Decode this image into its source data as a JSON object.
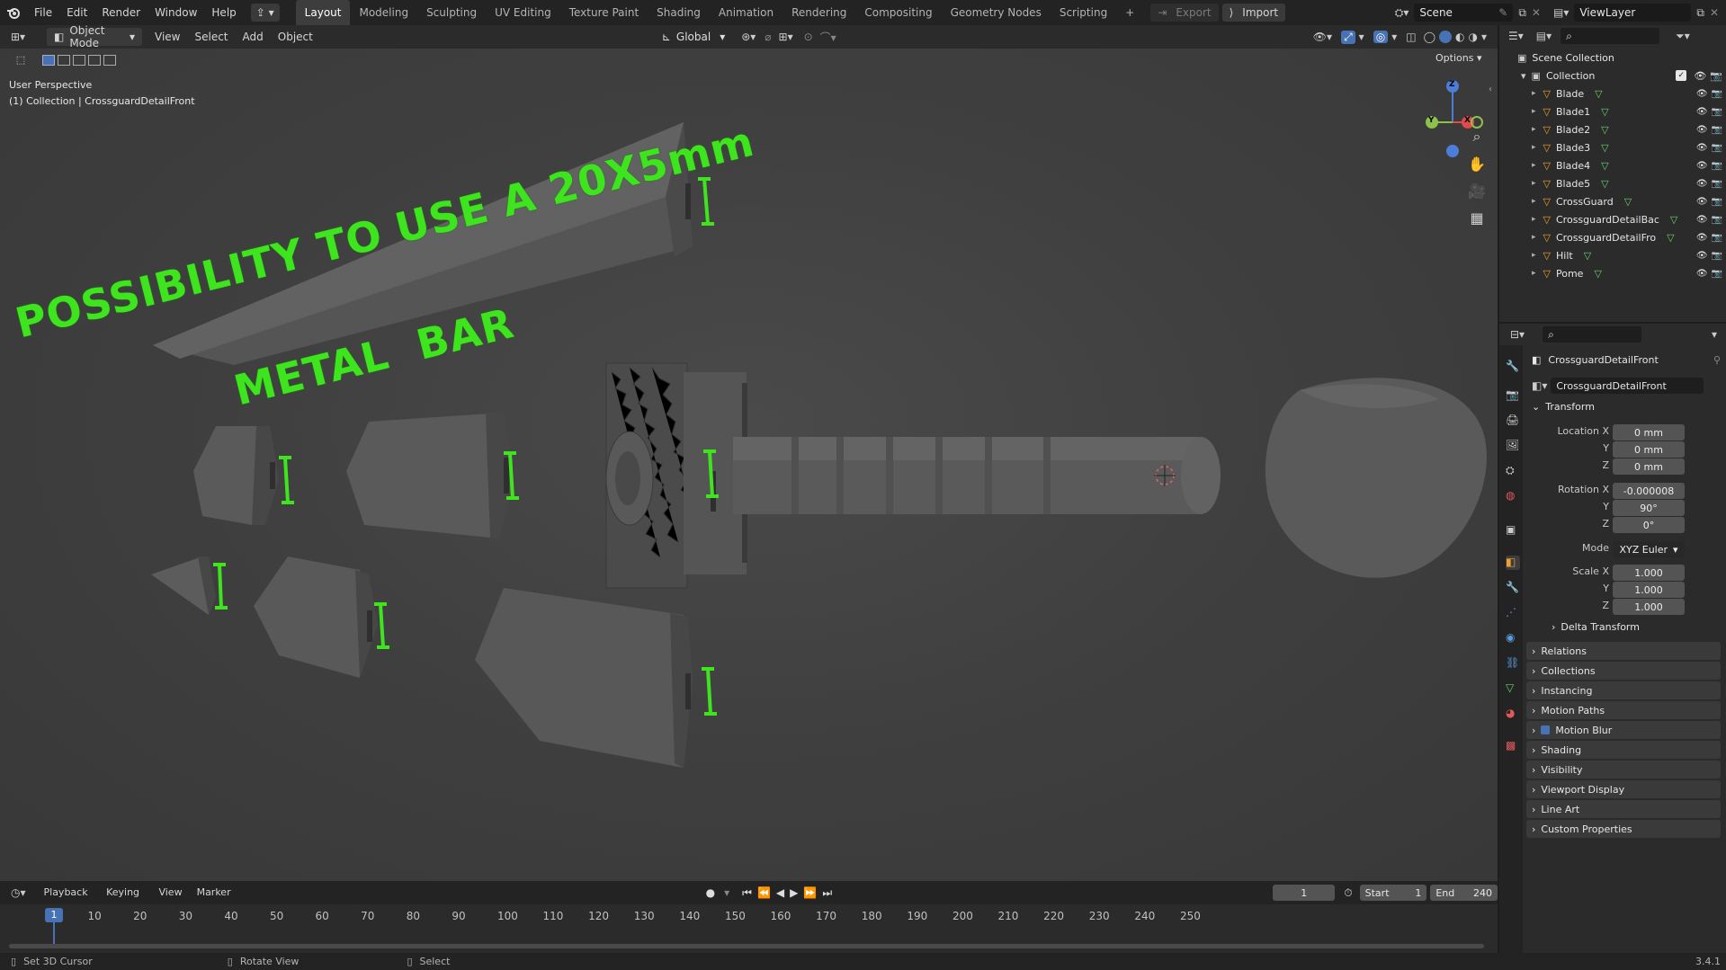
{
  "app": {
    "logo_icon": "blender-logo-icon"
  },
  "menu": [
    "File",
    "Edit",
    "Render",
    "Window",
    "Help"
  ],
  "workspaces": {
    "tabs": [
      "Layout",
      "Modeling",
      "Sculpting",
      "UV Editing",
      "Texture Paint",
      "Shading",
      "Animation",
      "Rendering",
      "Compositing",
      "Geometry Nodes",
      "Scripting"
    ],
    "active": "Layout",
    "add": "+"
  },
  "topbar": {
    "export_label": "Export",
    "import_label": "Import",
    "scene_label": "Scene",
    "viewlayer_label": "ViewLayer"
  },
  "viewport_header": {
    "mode": "Object Mode",
    "menus": [
      "View",
      "Select",
      "Add",
      "Object"
    ],
    "transform_orientation": "Global",
    "options_label": "Options"
  },
  "viewport": {
    "view_name": "User Perspective",
    "context": "(1) Collection | CrossguardDetailFront",
    "overlay_text_line1": "POSSIBILITY TO USE A 20X5mm",
    "overlay_text_line2": "METAL  BAR",
    "overlay_color": "#3ee51f",
    "gizmo": {
      "z": "Z",
      "y": "Y",
      "x": "X"
    }
  },
  "outliner": {
    "scene_collection": "Scene Collection",
    "collection": "Collection",
    "items": [
      {
        "name": "Blade"
      },
      {
        "name": "Blade1"
      },
      {
        "name": "Blade2"
      },
      {
        "name": "Blade3"
      },
      {
        "name": "Blade4"
      },
      {
        "name": "Blade5"
      },
      {
        "name": "CrossGuard"
      },
      {
        "name": "CrossguardDetailBac"
      },
      {
        "name": "CrossguardDetailFro"
      },
      {
        "name": "Hilt"
      },
      {
        "name": "Pome"
      }
    ]
  },
  "properties": {
    "object_name": "CrossguardDetailFront",
    "datablock_name": "CrossguardDetailFront",
    "transform_label": "Transform",
    "location": {
      "label": "Location X",
      "x": "0 mm",
      "y": "0 mm",
      "z": "0 mm"
    },
    "rotation": {
      "label": "Rotation X",
      "x": "-0.000008",
      "y": "90°",
      "z": "0°"
    },
    "mode_label": "Mode",
    "mode_value": "XYZ Euler",
    "scale": {
      "label": "Scale X",
      "x": "1.000",
      "y": "1.000",
      "z": "1.000"
    },
    "axis_y": "Y",
    "axis_z": "Z",
    "delta_transform": "Delta Transform",
    "panels": [
      "Relations",
      "Collections",
      "Instancing",
      "Motion Paths",
      "Motion Blur",
      "Shading",
      "Visibility",
      "Viewport Display",
      "Line Art",
      "Custom Properties"
    ]
  },
  "timeline": {
    "menus": [
      "Playback",
      "Keying",
      "View",
      "Marker"
    ],
    "current_frame": "1",
    "start_label": "Start",
    "start_value": "1",
    "end_label": "End",
    "end_value": "240",
    "ticks": [
      "1",
      "10",
      "20",
      "30",
      "40",
      "50",
      "60",
      "70",
      "80",
      "90",
      "100",
      "110",
      "120",
      "130",
      "140",
      "150",
      "160",
      "170",
      "180",
      "190",
      "200",
      "210",
      "220",
      "230",
      "240",
      "250"
    ]
  },
  "statusbar": {
    "hint1": "Set 3D Cursor",
    "hint2": "Rotate View",
    "hint3": "Select",
    "version": "3.4.1"
  }
}
